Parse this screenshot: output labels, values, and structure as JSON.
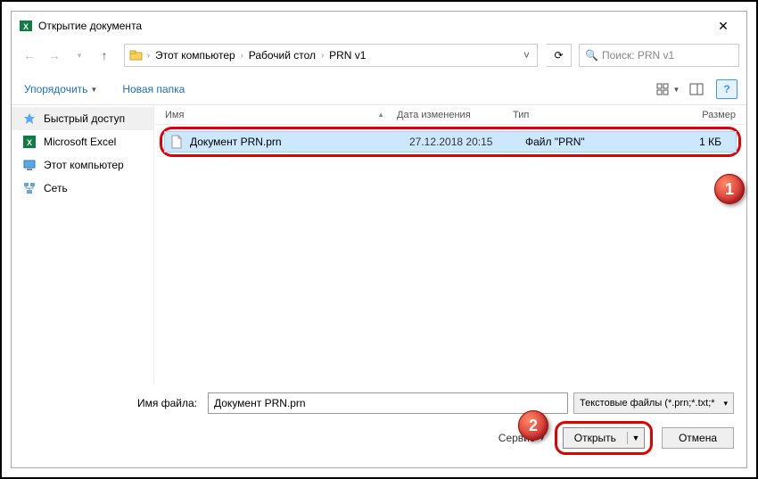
{
  "titlebar": {
    "title": "Открытие документа"
  },
  "nav": {
    "breadcrumb": [
      "Этот компьютер",
      "Рабочий стол",
      "PRN v1"
    ],
    "search_placeholder": "Поиск: PRN v1"
  },
  "toolbar": {
    "organize": "Упорядочить",
    "newfolder": "Новая папка"
  },
  "sidebar": {
    "items": [
      {
        "label": "Быстрый доступ"
      },
      {
        "label": "Microsoft Excel"
      },
      {
        "label": "Этот компьютер"
      },
      {
        "label": "Сеть"
      }
    ]
  },
  "cols": {
    "name": "Имя",
    "date": "Дата изменения",
    "type": "Тип",
    "size": "Размер"
  },
  "file": {
    "name": "Документ PRN.prn",
    "date": "27.12.2018 20:15",
    "type": "Файл \"PRN\"",
    "size": "1 КБ"
  },
  "bottom": {
    "filename_label": "Имя файла:",
    "filename_value": "Документ PRN.prn",
    "filter": "Текстовые файлы (*.prn;*.txt;*",
    "service": "Сервис",
    "open": "Открыть",
    "cancel": "Отмена"
  },
  "badges": {
    "b1": "1",
    "b2": "2"
  }
}
